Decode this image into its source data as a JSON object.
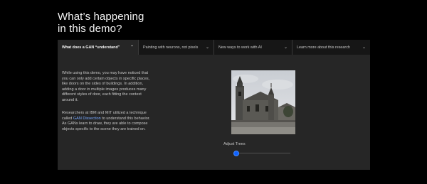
{
  "heading": {
    "line1": "What’s happening",
    "line2": "in this demo?"
  },
  "tabs": [
    {
      "label": "What does a GAN “understand”",
      "active": true,
      "icon": "chevron-up-icon",
      "chevron": "⌃"
    },
    {
      "label": "Painting with neurons, not pixels",
      "active": false,
      "icon": "chevron-down-icon",
      "chevron": "⌄"
    },
    {
      "label": "New ways to work with AI",
      "active": false,
      "icon": "chevron-down-icon",
      "chevron": "⌄"
    },
    {
      "label": "Learn more about this research",
      "active": false,
      "icon": "chevron-down-icon",
      "chevron": "⌄"
    }
  ],
  "panel": {
    "para1": "While using this demo, you may have noticed that you can only add certain objects in specific places, like doors on the sides of buildings. In addition, adding a door in multiple images produces many different styles of door, each fitting the context around it.",
    "para2_before": "Researchers at IBM and MIT utilized a technique called ",
    "para2_link": "GAN Dissection",
    "para2_after": " to understand this behavior. As GANs learn to draw, they are able to compose objects specific to the scene they are trained on.",
    "slider_label": "Adjust Trees",
    "slider_value": 0.05
  },
  "colors": {
    "background": "#000000",
    "panel": "#262626",
    "link": "#78a9ff",
    "accent": "#0f62fe"
  }
}
